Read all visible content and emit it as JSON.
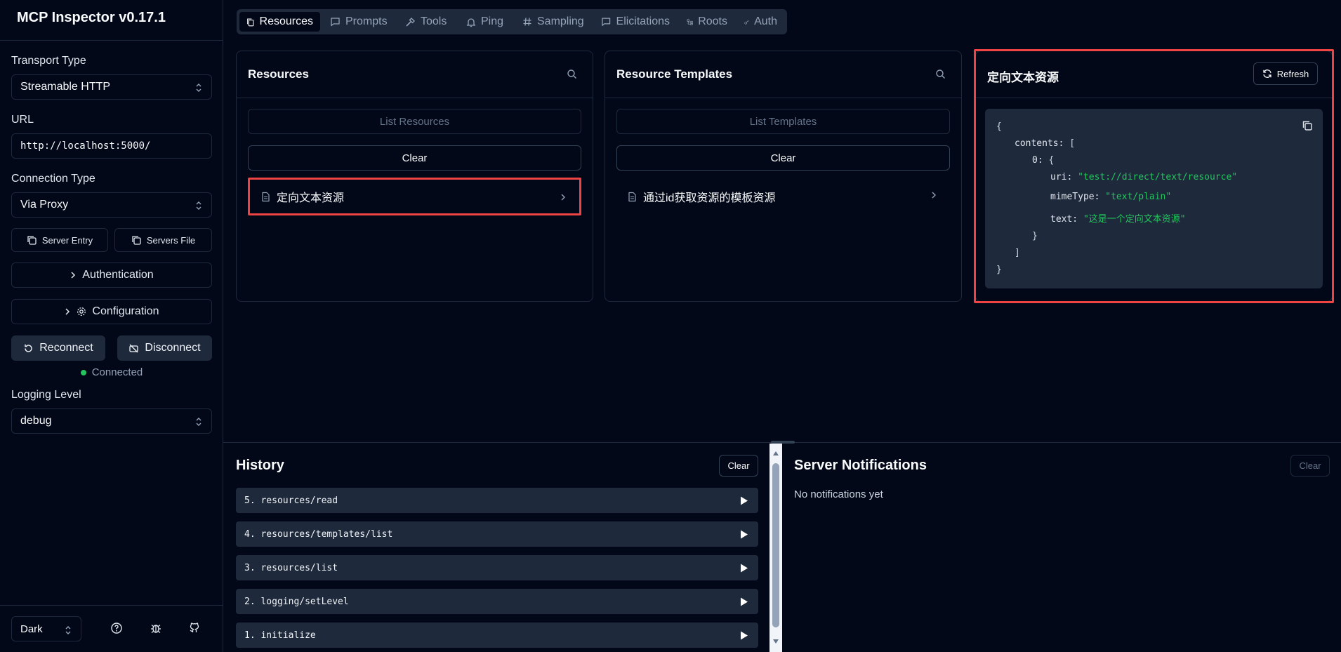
{
  "app": {
    "title": "MCP Inspector v0.17.1"
  },
  "sidebar": {
    "transport_label": "Transport Type",
    "transport_value": "Streamable HTTP",
    "url_label": "URL",
    "url_value": "http://localhost:5000/",
    "connection_label": "Connection Type",
    "connection_value": "Via Proxy",
    "server_entry_label": "Server Entry",
    "servers_file_label": "Servers File",
    "authentication_label": "Authentication",
    "configuration_label": "Configuration",
    "reconnect_label": "Reconnect",
    "disconnect_label": "Disconnect",
    "status_text": "Connected",
    "logging_label": "Logging Level",
    "logging_value": "debug",
    "theme_value": "Dark"
  },
  "tabs": [
    {
      "label": "Resources",
      "icon": "resources-icon",
      "active": true
    },
    {
      "label": "Prompts",
      "icon": "message-icon"
    },
    {
      "label": "Tools",
      "icon": "hammer-icon"
    },
    {
      "label": "Ping",
      "icon": "bell-icon"
    },
    {
      "label": "Sampling",
      "icon": "hash-icon"
    },
    {
      "label": "Elicitations",
      "icon": "message-icon"
    },
    {
      "label": "Roots",
      "icon": "tree-icon"
    },
    {
      "label": "Auth",
      "icon": "key-icon"
    }
  ],
  "resources_panel": {
    "title": "Resources",
    "list_button": "List Resources",
    "clear_button": "Clear",
    "items": [
      {
        "label": "定向文本资源"
      }
    ]
  },
  "templates_panel": {
    "title": "Resource Templates",
    "list_button": "List Templates",
    "clear_button": "Clear",
    "items": [
      {
        "label": "通过id获取资源的模板资源"
      }
    ]
  },
  "detail_panel": {
    "title": "定向文本资源",
    "refresh_button": "Refresh",
    "json": {
      "open_brace": "{",
      "contents_key": "contents:",
      "open_bracket": "[",
      "index_key": "0:",
      "inner_open": "{",
      "uri_key": "uri:",
      "uri_value": "\"test://direct/text/resource\"",
      "mime_key": "mimeType:",
      "mime_value": "\"text/plain\"",
      "text_key": "text:",
      "text_value": "\"这是一个定向文本资源\"",
      "inner_close": "}",
      "close_bracket": "]",
      "close_brace": "}"
    }
  },
  "history": {
    "title": "History",
    "clear_button": "Clear",
    "items": [
      "5. resources/read",
      "4. resources/templates/list",
      "3. resources/list",
      "2. logging/setLevel",
      "1. initialize"
    ]
  },
  "notifications": {
    "title": "Server Notifications",
    "clear_button": "Clear",
    "empty_text": "No notifications yet"
  },
  "colors": {
    "background": "#020817",
    "panel_border": "#1e293b",
    "highlight": "#ef4444",
    "status_green": "#22c55e",
    "json_string": "#22c55e"
  }
}
